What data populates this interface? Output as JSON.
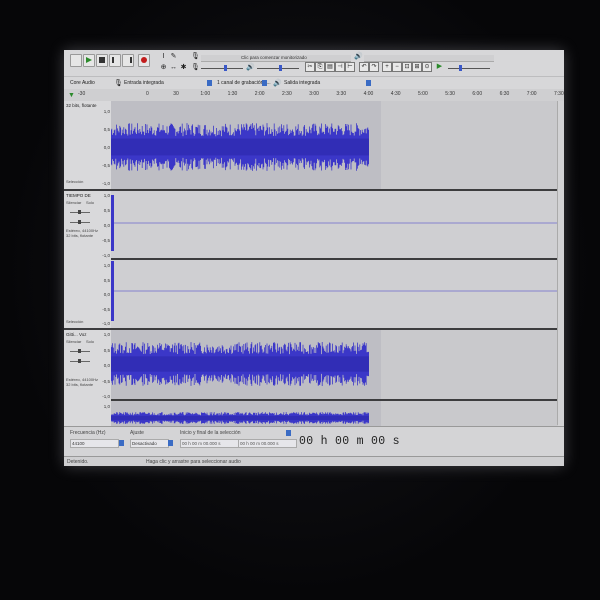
{
  "transport": {
    "pause_icon": "pause-icon",
    "play_icon": "play-icon",
    "stop_icon": "stop-icon",
    "skip_start_icon": "skip-start-icon",
    "skip_end_icon": "skip-end-icon",
    "record_icon": "record-icon"
  },
  "meters": {
    "record_hint": "Clic para comenzar monitorizado",
    "record_scale": [
      "-54",
      "-48",
      "-18",
      "-12",
      "-6",
      "0"
    ],
    "play_scale": [
      "-54",
      "-48",
      "-42",
      "-36",
      "-30",
      "-24",
      "-18",
      "-12",
      "-6",
      "0"
    ]
  },
  "devices": {
    "host": "Core Audio",
    "input": "Entrada integrada",
    "channels": "1 canal de grabación (...",
    "output": "Salida integrada"
  },
  "ruler": {
    "labels": [
      "-30",
      "0",
      "30",
      "1:00",
      "1:30",
      "2:00",
      "2:30",
      "3:00",
      "3:30",
      "4:00",
      "4:30",
      "5:00",
      "5:30",
      "6:00",
      "6:30",
      "7:00",
      "7:30",
      "8:00"
    ]
  },
  "tracks": [
    {
      "name": "32 bits, flotante",
      "scale": [
        "1,0",
        "0,5",
        "0,0",
        "-0,5",
        "-1,0"
      ],
      "select_label": "Selección"
    },
    {
      "name": "TIEMPO DE",
      "mute": "Silenciar",
      "solo": "Solo",
      "info1": "Estéreo, 44100Hz",
      "info2": "32 bits, flotante",
      "scale_top": [
        "1,0",
        "0,5",
        "0,0",
        "-0,5",
        "-1,0"
      ],
      "scale_bottom": [
        "1,0",
        "0,5",
        "0,0",
        "-0,5",
        "-1,0"
      ],
      "select_label": "Selección"
    },
    {
      "name": "Gitti... Voz",
      "mute": "Silenciar",
      "solo": "Solo",
      "info1": "Estéreo, 44100Hz",
      "info2": "32 bits, flotante",
      "scale_top": [
        "1,0",
        "0,5",
        "0,0",
        "-0,5",
        "-1,0"
      ],
      "scale_bottom": [
        "1,0"
      ]
    }
  ],
  "selection_toolbar": {
    "rate_label": "Frecuencia (Hz)",
    "rate_value": "44100",
    "snap_label": "Ajuste",
    "snap_value": "Desactivado",
    "range_label": "Inicio y final de la selección",
    "start_value": "00 h 00 m 00.000 s",
    "end_value": "00 h 00 m 00.000 s",
    "audio_position": "00 h 00 m 00 s"
  },
  "status": {
    "state": "Detenido.",
    "hint": "Haga clic y arrastre para seleccionar audio"
  },
  "colors": {
    "waveform": "#3b37c8",
    "waveform_dark": "#2a27a8",
    "track_bg": "#c9c9cc"
  }
}
